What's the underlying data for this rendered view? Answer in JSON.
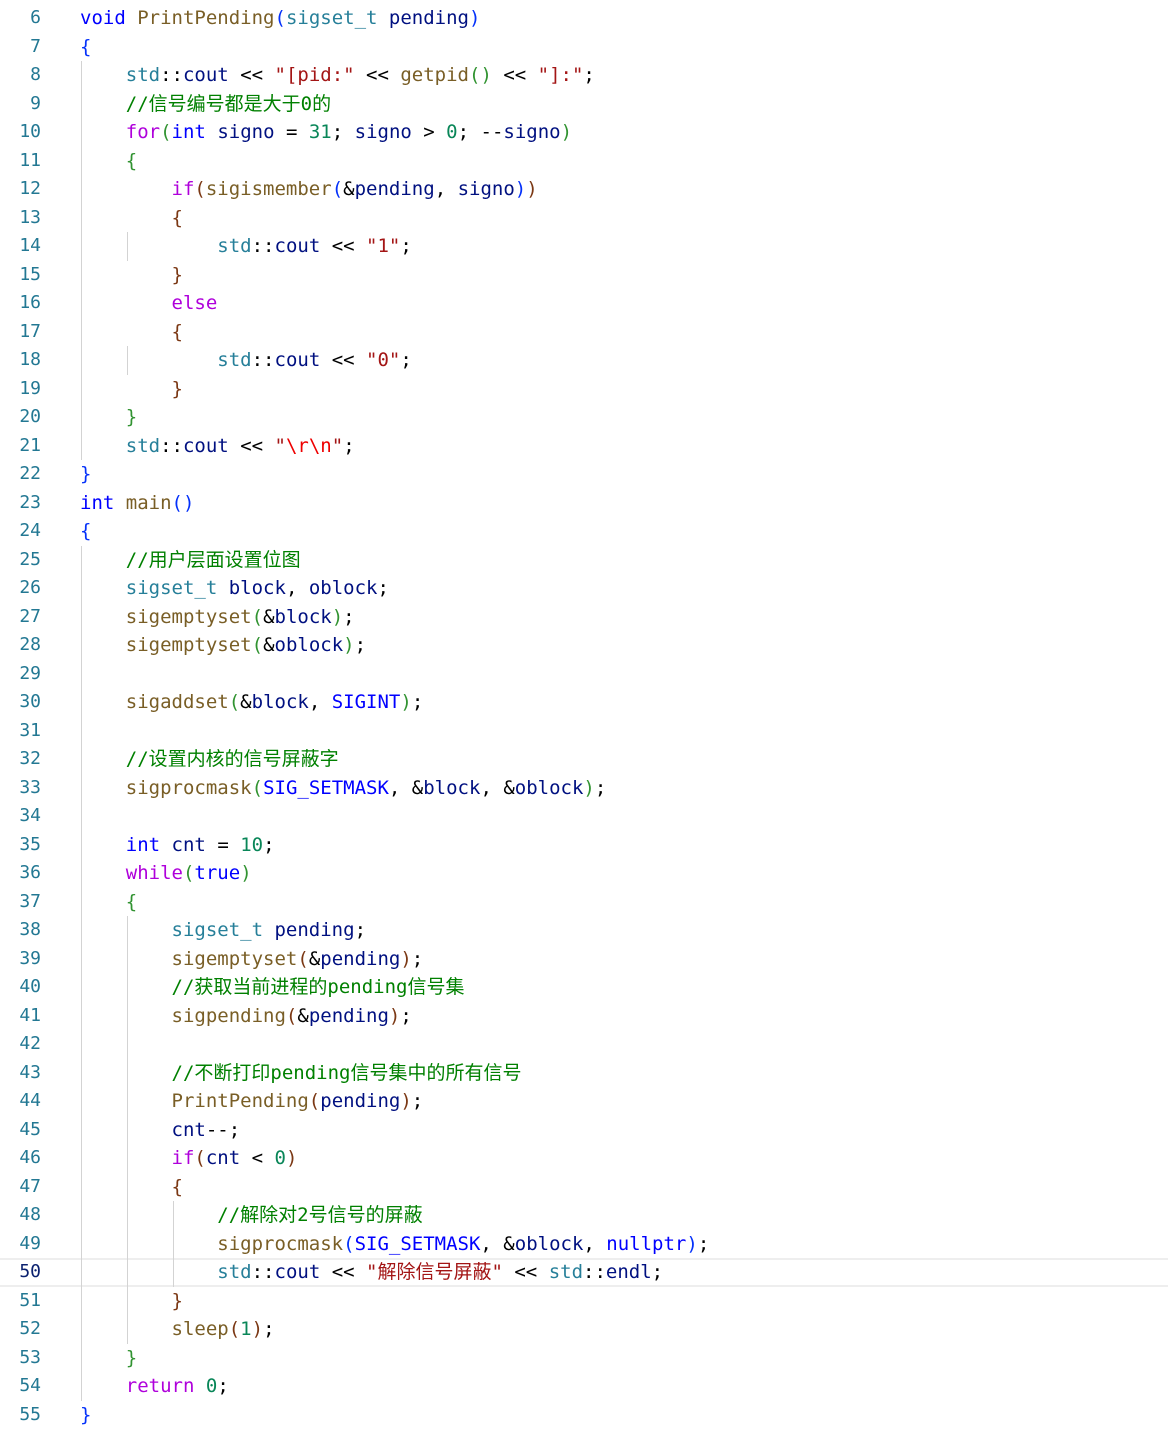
{
  "editor": {
    "current_line": "50",
    "lines": [
      {
        "n": "6",
        "tokens": [
          [
            "kw",
            "void"
          ],
          [
            "op",
            " "
          ],
          [
            "fn",
            "PrintPending"
          ],
          [
            "b1",
            "("
          ],
          [
            "ty",
            "sigset_t"
          ],
          [
            "op",
            " "
          ],
          [
            "var",
            "pending"
          ],
          [
            "b1",
            ")"
          ]
        ]
      },
      {
        "n": "7",
        "tokens": [
          [
            "b1",
            "{"
          ]
        ]
      },
      {
        "n": "8",
        "tokens": [
          [
            "op",
            "    "
          ],
          [
            "ty",
            "std"
          ],
          [
            "op",
            "::"
          ],
          [
            "var",
            "cout"
          ],
          [
            "op",
            " << "
          ],
          [
            "str",
            "\"[pid:\""
          ],
          [
            "op",
            " << "
          ],
          [
            "fn",
            "getpid"
          ],
          [
            "b2",
            "()"
          ],
          [
            "op",
            " << "
          ],
          [
            "str",
            "\"]:\""
          ],
          [
            "op",
            ";"
          ]
        ]
      },
      {
        "n": "9",
        "tokens": [
          [
            "op",
            "    "
          ],
          [
            "cmt",
            "//信号编号都是大于0的"
          ]
        ]
      },
      {
        "n": "10",
        "tokens": [
          [
            "op",
            "    "
          ],
          [
            "ctl",
            "for"
          ],
          [
            "b2",
            "("
          ],
          [
            "kw",
            "int"
          ],
          [
            "op",
            " "
          ],
          [
            "var",
            "signo"
          ],
          [
            "op",
            " = "
          ],
          [
            "num",
            "31"
          ],
          [
            "op",
            "; "
          ],
          [
            "var",
            "signo"
          ],
          [
            "op",
            " > "
          ],
          [
            "num",
            "0"
          ],
          [
            "op",
            "; --"
          ],
          [
            "var",
            "signo"
          ],
          [
            "b2",
            ")"
          ]
        ]
      },
      {
        "n": "11",
        "tokens": [
          [
            "op",
            "    "
          ],
          [
            "b2",
            "{"
          ]
        ]
      },
      {
        "n": "12",
        "tokens": [
          [
            "op",
            "        "
          ],
          [
            "ctl",
            "if"
          ],
          [
            "b3",
            "("
          ],
          [
            "fn",
            "sigismember"
          ],
          [
            "b1",
            "("
          ],
          [
            "op",
            "&"
          ],
          [
            "var",
            "pending"
          ],
          [
            "op",
            ", "
          ],
          [
            "var",
            "signo"
          ],
          [
            "b1",
            ")"
          ],
          [
            "b3",
            ")"
          ]
        ]
      },
      {
        "n": "13",
        "tokens": [
          [
            "op",
            "        "
          ],
          [
            "b3",
            "{"
          ]
        ]
      },
      {
        "n": "14",
        "tokens": [
          [
            "op",
            "            "
          ],
          [
            "ty",
            "std"
          ],
          [
            "op",
            "::"
          ],
          [
            "var",
            "cout"
          ],
          [
            "op",
            " << "
          ],
          [
            "str",
            "\"1\""
          ],
          [
            "op",
            ";"
          ]
        ]
      },
      {
        "n": "15",
        "tokens": [
          [
            "op",
            "        "
          ],
          [
            "b3",
            "}"
          ]
        ]
      },
      {
        "n": "16",
        "tokens": [
          [
            "op",
            "        "
          ],
          [
            "ctl",
            "else"
          ]
        ]
      },
      {
        "n": "17",
        "tokens": [
          [
            "op",
            "        "
          ],
          [
            "b3",
            "{"
          ]
        ]
      },
      {
        "n": "18",
        "tokens": [
          [
            "op",
            "            "
          ],
          [
            "ty",
            "std"
          ],
          [
            "op",
            "::"
          ],
          [
            "var",
            "cout"
          ],
          [
            "op",
            " << "
          ],
          [
            "str",
            "\"0\""
          ],
          [
            "op",
            ";"
          ]
        ]
      },
      {
        "n": "19",
        "tokens": [
          [
            "op",
            "        "
          ],
          [
            "b3",
            "}"
          ]
        ]
      },
      {
        "n": "20",
        "tokens": [
          [
            "op",
            "    "
          ],
          [
            "b2",
            "}"
          ]
        ]
      },
      {
        "n": "21",
        "tokens": [
          [
            "op",
            "    "
          ],
          [
            "ty",
            "std"
          ],
          [
            "op",
            "::"
          ],
          [
            "var",
            "cout"
          ],
          [
            "op",
            " << "
          ],
          [
            "str",
            "\""
          ],
          [
            "esc",
            "\\r\\n"
          ],
          [
            "str",
            "\""
          ],
          [
            "op",
            ";"
          ]
        ]
      },
      {
        "n": "22",
        "tokens": [
          [
            "b1",
            "}"
          ]
        ]
      },
      {
        "n": "23",
        "tokens": [
          [
            "kw",
            "int"
          ],
          [
            "op",
            " "
          ],
          [
            "fn",
            "main"
          ],
          [
            "b1",
            "()"
          ]
        ]
      },
      {
        "n": "24",
        "tokens": [
          [
            "b1",
            "{"
          ]
        ]
      },
      {
        "n": "25",
        "tokens": [
          [
            "op",
            "    "
          ],
          [
            "cmt",
            "//用户层面设置位图"
          ]
        ]
      },
      {
        "n": "26",
        "tokens": [
          [
            "op",
            "    "
          ],
          [
            "ty",
            "sigset_t"
          ],
          [
            "op",
            " "
          ],
          [
            "var",
            "block"
          ],
          [
            "op",
            ", "
          ],
          [
            "var",
            "oblock"
          ],
          [
            "op",
            ";"
          ]
        ]
      },
      {
        "n": "27",
        "tokens": [
          [
            "op",
            "    "
          ],
          [
            "fn",
            "sigemptyset"
          ],
          [
            "b2",
            "("
          ],
          [
            "op",
            "&"
          ],
          [
            "var",
            "block"
          ],
          [
            "b2",
            ")"
          ],
          [
            "op",
            ";"
          ]
        ]
      },
      {
        "n": "28",
        "tokens": [
          [
            "op",
            "    "
          ],
          [
            "fn",
            "sigemptyset"
          ],
          [
            "b2",
            "("
          ],
          [
            "op",
            "&"
          ],
          [
            "var",
            "oblock"
          ],
          [
            "b2",
            ")"
          ],
          [
            "op",
            ";"
          ]
        ]
      },
      {
        "n": "29",
        "tokens": []
      },
      {
        "n": "30",
        "tokens": [
          [
            "op",
            "    "
          ],
          [
            "fn",
            "sigaddset"
          ],
          [
            "b2",
            "("
          ],
          [
            "op",
            "&"
          ],
          [
            "var",
            "block"
          ],
          [
            "op",
            ", "
          ],
          [
            "mac",
            "SIGINT"
          ],
          [
            "b2",
            ")"
          ],
          [
            "op",
            ";"
          ]
        ]
      },
      {
        "n": "31",
        "tokens": []
      },
      {
        "n": "32",
        "tokens": [
          [
            "op",
            "    "
          ],
          [
            "cmt",
            "//设置内核的信号屏蔽字"
          ]
        ]
      },
      {
        "n": "33",
        "tokens": [
          [
            "op",
            "    "
          ],
          [
            "fn",
            "sigprocmask"
          ],
          [
            "b2",
            "("
          ],
          [
            "mac",
            "SIG_SETMASK"
          ],
          [
            "op",
            ", &"
          ],
          [
            "var",
            "block"
          ],
          [
            "op",
            ", &"
          ],
          [
            "var",
            "oblock"
          ],
          [
            "b2",
            ")"
          ],
          [
            "op",
            ";"
          ]
        ]
      },
      {
        "n": "34",
        "tokens": []
      },
      {
        "n": "35",
        "tokens": [
          [
            "op",
            "    "
          ],
          [
            "kw",
            "int"
          ],
          [
            "op",
            " "
          ],
          [
            "var",
            "cnt"
          ],
          [
            "op",
            " = "
          ],
          [
            "num",
            "10"
          ],
          [
            "op",
            ";"
          ]
        ]
      },
      {
        "n": "36",
        "tokens": [
          [
            "op",
            "    "
          ],
          [
            "ctl",
            "while"
          ],
          [
            "b2",
            "("
          ],
          [
            "kw",
            "true"
          ],
          [
            "b2",
            ")"
          ]
        ]
      },
      {
        "n": "37",
        "tokens": [
          [
            "op",
            "    "
          ],
          [
            "b2",
            "{"
          ]
        ]
      },
      {
        "n": "38",
        "tokens": [
          [
            "op",
            "        "
          ],
          [
            "ty",
            "sigset_t"
          ],
          [
            "op",
            " "
          ],
          [
            "var",
            "pending"
          ],
          [
            "op",
            ";"
          ]
        ]
      },
      {
        "n": "39",
        "tokens": [
          [
            "op",
            "        "
          ],
          [
            "fn",
            "sigemptyset"
          ],
          [
            "b3",
            "("
          ],
          [
            "op",
            "&"
          ],
          [
            "var",
            "pending"
          ],
          [
            "b3",
            ")"
          ],
          [
            "op",
            ";"
          ]
        ]
      },
      {
        "n": "40",
        "tokens": [
          [
            "op",
            "        "
          ],
          [
            "cmt",
            "//获取当前进程的pending信号集"
          ]
        ]
      },
      {
        "n": "41",
        "tokens": [
          [
            "op",
            "        "
          ],
          [
            "fn",
            "sigpending"
          ],
          [
            "b3",
            "("
          ],
          [
            "op",
            "&"
          ],
          [
            "var",
            "pending"
          ],
          [
            "b3",
            ")"
          ],
          [
            "op",
            ";"
          ]
        ]
      },
      {
        "n": "42",
        "tokens": []
      },
      {
        "n": "43",
        "tokens": [
          [
            "op",
            "        "
          ],
          [
            "cmt",
            "//不断打印pending信号集中的所有信号"
          ]
        ]
      },
      {
        "n": "44",
        "tokens": [
          [
            "op",
            "        "
          ],
          [
            "fn",
            "PrintPending"
          ],
          [
            "b3",
            "("
          ],
          [
            "var",
            "pending"
          ],
          [
            "b3",
            ")"
          ],
          [
            "op",
            ";"
          ]
        ]
      },
      {
        "n": "45",
        "tokens": [
          [
            "op",
            "        "
          ],
          [
            "var",
            "cnt"
          ],
          [
            "op",
            "--;"
          ]
        ]
      },
      {
        "n": "46",
        "tokens": [
          [
            "op",
            "        "
          ],
          [
            "ctl",
            "if"
          ],
          [
            "b3",
            "("
          ],
          [
            "var",
            "cnt"
          ],
          [
            "op",
            " < "
          ],
          [
            "num",
            "0"
          ],
          [
            "b3",
            ")"
          ]
        ]
      },
      {
        "n": "47",
        "tokens": [
          [
            "op",
            "        "
          ],
          [
            "b3",
            "{"
          ]
        ]
      },
      {
        "n": "48",
        "tokens": [
          [
            "op",
            "            "
          ],
          [
            "cmt",
            "//解除对2号信号的屏蔽"
          ]
        ]
      },
      {
        "n": "49",
        "tokens": [
          [
            "op",
            "            "
          ],
          [
            "fn",
            "sigprocmask"
          ],
          [
            "b1",
            "("
          ],
          [
            "mac",
            "SIG_SETMASK"
          ],
          [
            "op",
            ", &"
          ],
          [
            "var",
            "oblock"
          ],
          [
            "op",
            ", "
          ],
          [
            "kw",
            "nullptr"
          ],
          [
            "b1",
            ")"
          ],
          [
            "op",
            ";"
          ]
        ]
      },
      {
        "n": "50",
        "tokens": [
          [
            "op",
            "            "
          ],
          [
            "ty",
            "std"
          ],
          [
            "op",
            "::"
          ],
          [
            "var",
            "cout"
          ],
          [
            "op",
            " << "
          ],
          [
            "str",
            "\"解除信号屏蔽\""
          ],
          [
            "op",
            " << "
          ],
          [
            "ty",
            "std"
          ],
          [
            "op",
            "::"
          ],
          [
            "var",
            "endl"
          ],
          [
            "op",
            ";"
          ]
        ]
      },
      {
        "n": "51",
        "tokens": [
          [
            "op",
            "        "
          ],
          [
            "b3",
            "}"
          ]
        ]
      },
      {
        "n": "52",
        "tokens": [
          [
            "op",
            "        "
          ],
          [
            "fn",
            "sleep"
          ],
          [
            "b3",
            "("
          ],
          [
            "num",
            "1"
          ],
          [
            "b3",
            ")"
          ],
          [
            "op",
            ";"
          ]
        ]
      },
      {
        "n": "53",
        "tokens": [
          [
            "op",
            "    "
          ],
          [
            "b2",
            "}"
          ]
        ]
      },
      {
        "n": "54",
        "tokens": [
          [
            "op",
            "    "
          ],
          [
            "ctl",
            "return"
          ],
          [
            "op",
            " "
          ],
          [
            "num",
            "0"
          ],
          [
            "op",
            ";"
          ]
        ]
      },
      {
        "n": "55",
        "tokens": [
          [
            "b1",
            "}"
          ]
        ]
      }
    ]
  }
}
